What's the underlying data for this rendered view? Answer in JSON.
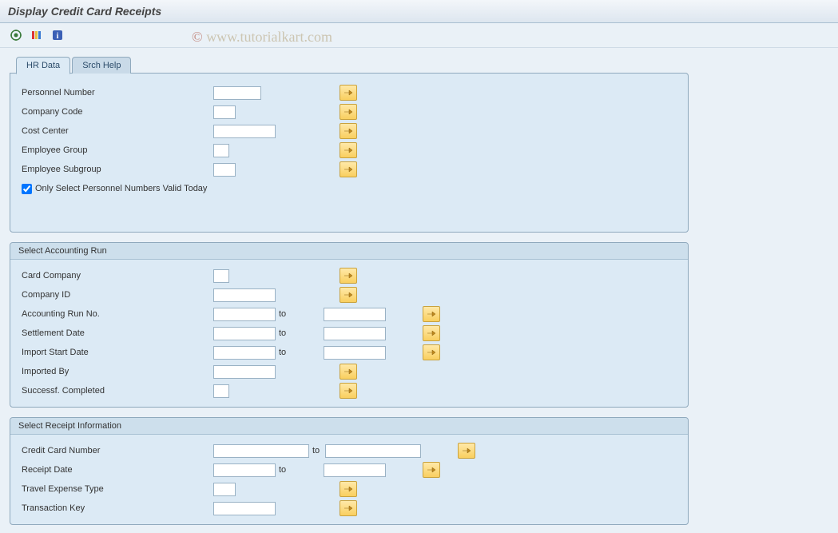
{
  "title": "Display Credit Card Receipts",
  "watermark": {
    "copy": "©",
    "text": " www.tutorialkart.com"
  },
  "tabs": {
    "hr": "HR Data",
    "srch": "Srch Help"
  },
  "hr": {
    "personnel_number": "Personnel Number",
    "company_code": "Company Code",
    "cost_center": "Cost Center",
    "employee_group": "Employee Group",
    "employee_subgroup": "Employee Subgroup",
    "only_valid_today": "Only Select Personnel Numbers Valid Today"
  },
  "accounting": {
    "title": "Select Accounting Run",
    "card_company": "Card Company",
    "company_id": "Company ID",
    "accounting_run_no": "Accounting Run No.",
    "settlement_date": "Settlement Date",
    "import_start_date": "Import Start Date",
    "imported_by": "Imported By",
    "success_completed": "Successf. Completed"
  },
  "receipt": {
    "title": "Select Receipt Information",
    "credit_card_number": "Credit Card Number",
    "receipt_date": "Receipt Date",
    "travel_expense_type": "Travel Expense Type",
    "transaction_key": "Transaction Key"
  },
  "common": {
    "to": "to"
  }
}
